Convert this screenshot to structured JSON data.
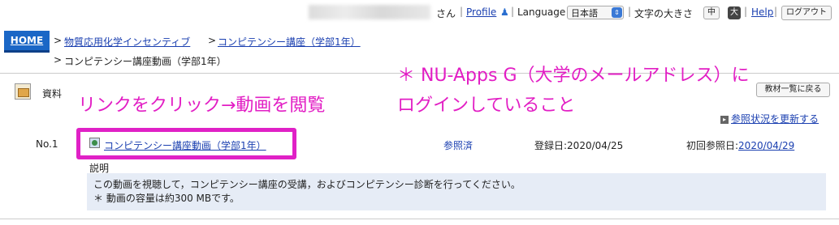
{
  "topbar": {
    "san": "さん",
    "profile": "Profile",
    "profile_icon": "person-icon",
    "language_label": "Language",
    "language_value": "日本語",
    "fontsize_label": "文字の大きさ",
    "fontsize_medium": "中",
    "fontsize_large": "大",
    "help": "Help",
    "logout": "ログアウト"
  },
  "breadcrumb": {
    "home": "HOME",
    "level1": "物質応用化学インセンティブ",
    "level2": "コンピテンシー講座（学部1年）",
    "current": "コンピテンシー講座動画（学部1年）"
  },
  "materials": {
    "label": "資料",
    "back_button": "教材一覧に戻る",
    "refresh": "参照状況を更新する"
  },
  "annotations": {
    "click_instruction": "リンクをクリック→動画を閲覧",
    "login_line1": "＊ NU-Apps G（大学のメールアドレス）に",
    "login_line2": "ログインしていること"
  },
  "row": {
    "no": "No.1",
    "title": "コンピテンシー講座動画（学部1年）",
    "status": "参照済",
    "registered": "登録日:2020/04/25",
    "first_ref_label": "初回参照日:",
    "first_ref_date": "2020/04/29",
    "desc_label": "説明",
    "desc_line1": "この動画を視聴して，コンピテンシー講座の受講，およびコンピテンシー診断を行ってください。",
    "desc_line2": "＊ 動画の容量は約300 MBです。"
  },
  "colors": {
    "annotation": "#e21ec4",
    "link": "#1a3fb0",
    "home_button": "#1b67c6",
    "desc_bg": "#e6ecf6"
  }
}
